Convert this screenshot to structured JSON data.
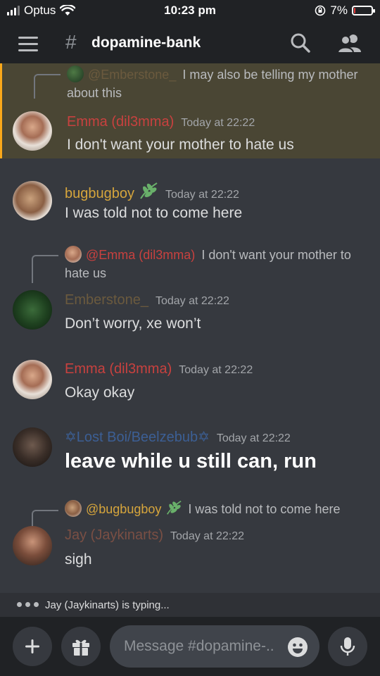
{
  "status_bar": {
    "carrier": "Optus",
    "time": "10:23 pm",
    "battery": "7%",
    "battery_level": 0.07
  },
  "header": {
    "channel": "dopamine-bank",
    "icons": [
      "menu-icon",
      "hash-icon",
      "search-icon",
      "members-icon"
    ]
  },
  "messages": [
    {
      "reply_to": {
        "mention": "@Emberstone_",
        "text": "I may also be telling my mother about this"
      },
      "author": "Emma (dil3mma)",
      "author_color": "#c8413f",
      "timestamp": "Today at 22:22",
      "content": "I don't want your mother to hate us",
      "highlighted": true
    },
    {
      "author": "bugbugboy",
      "author_color": "#d6a53c",
      "timestamp": "Today at 22:22",
      "content": "I was told not to come here",
      "badge": "leaf-icon"
    },
    {
      "reply_to": {
        "mention": "@Emma (dil3mma)",
        "text": "I don't want your mother to hate us"
      },
      "author": "Emberstone_",
      "author_color": "#6b5a3e",
      "timestamp": "Today at 22:22",
      "content": "Don’t worry, xe won’t"
    },
    {
      "author": "Emma (dil3mma)",
      "author_color": "#c8413f",
      "timestamp": "Today at 22:22",
      "content": "Okay okay"
    },
    {
      "author": "✡Lost Boi/Beelzebub✡",
      "author_color": "#3c5f95",
      "timestamp": "Today at 22:22",
      "content": "leave while u still can, run"
    },
    {
      "reply_to": {
        "mention": "@bugbugboy",
        "text": "I was told not to come here"
      },
      "author": "Jay (Jaykinarts)",
      "author_color": "#7a4f44",
      "timestamp": "Today at 22:22",
      "content": "sigh"
    }
  ],
  "typing": {
    "text": "Jay (Jaykinarts) is typing..."
  },
  "composer": {
    "placeholder": "Message #dopamine-.."
  },
  "colors": {
    "background": "#36393f",
    "header": "#202225",
    "highlight": "#4a4634",
    "highlight_bar": "#faa81a"
  }
}
